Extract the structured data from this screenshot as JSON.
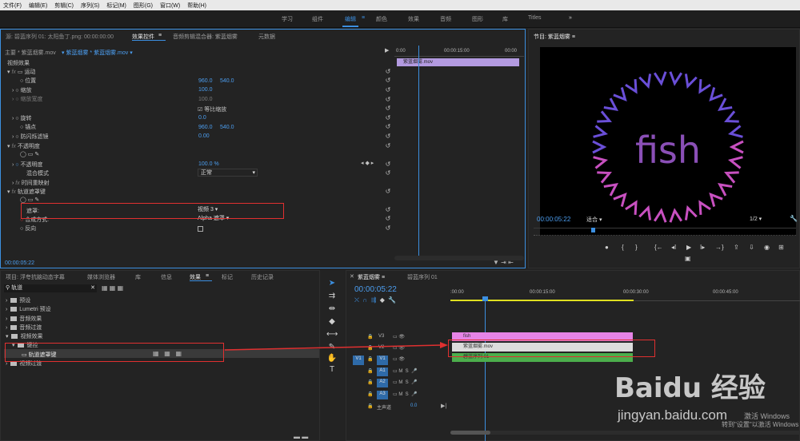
{
  "menu": [
    "文件(F)",
    "编辑(E)",
    "剪辑(C)",
    "序列(S)",
    "标记(M)",
    "图形(G)",
    "窗口(W)",
    "帮助(H)"
  ],
  "workspaces": {
    "learn": "学习",
    "assembly": "组件",
    "editing": "编辑",
    "color": "颜色",
    "effects": "效果",
    "audio": "音频",
    "graphics": "图形",
    "library": "库",
    "titles": "Titles"
  },
  "effect_controls": {
    "tabs": {
      "source": "源: 碧蓝序列 01: 太阳鱼丁.png: 00:00:00:00",
      "ec": "效果控件",
      "mixer": "音频剪辑混合器: 紫蓝烟雾",
      "meta": "元数据"
    },
    "master": "主要 * 紫蓝烟雾.mov",
    "clip": "紫蓝烟雾 * 紫蓝烟雾.mov",
    "ruler": [
      "0:00",
      "00:00:15:00",
      "00:00"
    ],
    "clip_bar": "紫蓝烟雾.mov",
    "video_effects": "视频效果",
    "motion": "运动",
    "position": "位置",
    "pos_x": "960.0",
    "pos_y": "540.0",
    "scale": "缩放",
    "scale_v": "100.0",
    "scale_w": "缩放宽度",
    "scale_w_v": "100.0",
    "uniform": "等比缩放",
    "rotation": "旋转",
    "rot_v": "0.0",
    "anchor": "锚点",
    "anc_x": "960.0",
    "anc_y": "540.0",
    "flicker": "防闪烁滤镜",
    "flicker_v": "0.00",
    "opacity_group": "不透明度",
    "opacity": "不透明度",
    "opacity_v": "100.0 %",
    "blend": "混合模式",
    "blend_v": "正常",
    "remap": "时间重映射",
    "matte": "轨道遮罩键",
    "mask": "遮罩:",
    "mask_v": "视频 3",
    "composite": "合成方式:",
    "composite_v": "Alpha 遮罩",
    "reverse": "反向",
    "timecode": "00:00:05:22"
  },
  "program": {
    "title": "节目: 紫蓝烟雾 ≡",
    "timecode": "00:00:05:22",
    "fit": "适合",
    "res": "1/2",
    "logo": "fish"
  },
  "project": {
    "tabs": {
      "p": "项目: 浮夸抗脑动态字幕",
      "mb": "媒体浏览器",
      "lib": "库",
      "info": "信息",
      "fx": "效果",
      "markers": "标记",
      "history": "历史记录"
    },
    "search": "轨道",
    "tree": {
      "presets": "预设",
      "lumetri": "Lumetri 预设",
      "afx": "音频效果",
      "atr": "音频过渡",
      "vfx": "视频效果",
      "keying": "键控",
      "matte": "轨道遮罩键",
      "vtr": "视频过渡"
    }
  },
  "timeline": {
    "tabs": {
      "t1": "紫蓝烟雾 ≡",
      "t2": "碧蓝序列 01"
    },
    "timecode": "00:00:05:22",
    "ruler": [
      ":00:00",
      "00:00:15:00",
      "00:00:30:00",
      "00:00:45:00"
    ],
    "tracks": {
      "v3": "V3",
      "v2": "V2",
      "v1": "V1",
      "a1": "A1",
      "a2": "A2",
      "a3": "A3",
      "master": "主声道",
      "master_v": "0.0"
    },
    "clips": {
      "fish": "fish",
      "smoke": "紫蓝烟雾.mov",
      "bg": "碧蓝序列 01"
    }
  },
  "watermark": {
    "main": "Baidu 经验",
    "sub": "jingyan.baidu.com",
    "win1": "激活 Windows",
    "win2": "转到\"设置\"以激活 Windows"
  },
  "colors": {
    "accent": "#3c8fe0",
    "v3_clip": "#e684e6",
    "v2_clip": "#dcdcdc",
    "v1_clip": "#4cae4c",
    "highlight": "#e03030"
  }
}
